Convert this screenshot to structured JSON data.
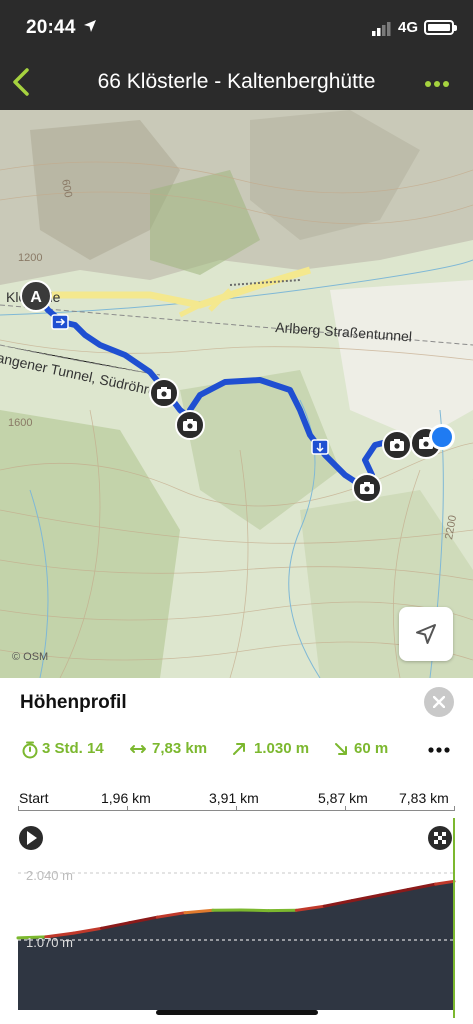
{
  "status_bar": {
    "time": "20:44",
    "network": "4G",
    "icons": [
      "location-arrow-icon",
      "signal-icon",
      "battery-icon"
    ]
  },
  "header": {
    "title": "66 Klösterle - Kaltenberghütte",
    "back_icon": "chevron-left-icon",
    "more_icon": "more-horizontal-icon"
  },
  "map": {
    "start_marker": "A",
    "labels": {
      "village": "Klösterle",
      "tunnel_1": "Arlberg Straßentunnel",
      "tunnel_2": "angener Tunnel, Südröhre",
      "contour_1200": "1200",
      "contour_1600": "1600",
      "contour_2200": "2200",
      "contour_600": "600"
    },
    "attribution": "© OSM",
    "photo_marker_icon": "camera-icon",
    "route_color": "#1f4fd1"
  },
  "elevation_panel": {
    "title": "Höhenprofil",
    "stats": {
      "duration": "3 Std. 14",
      "distance": "7,83 km",
      "ascent": "1.030 m",
      "descent": "60 m"
    },
    "distance_axis": [
      "Start",
      "1,96 km",
      "3,91 km",
      "5,87 km",
      "7,83 km"
    ],
    "elevation_labels": {
      "max": "2.040 m",
      "min": "1.070 m"
    },
    "accent_color": "#7cb82f"
  },
  "chart_data": {
    "type": "area",
    "title": "Höhenprofil",
    "xlabel": "",
    "ylabel": "",
    "x_unit": "km",
    "y_unit": "m",
    "x": [
      0,
      0.5,
      1.0,
      1.5,
      2.0,
      2.5,
      3.0,
      3.5,
      4.0,
      4.5,
      5.0,
      5.5,
      6.0,
      6.5,
      7.0,
      7.5,
      7.83
    ],
    "y": [
      1100,
      1115,
      1170,
      1240,
      1320,
      1400,
      1465,
      1500,
      1505,
      1495,
      1500,
      1560,
      1640,
      1720,
      1800,
      1880,
      1920
    ],
    "xlim": [
      0,
      7.83
    ],
    "ylim": [
      1070,
      2040
    ],
    "x_ticks": [
      "Start",
      "1,96 km",
      "3,91 km",
      "5,87 km",
      "7,83 km"
    ],
    "y_ticks": [
      "1.070 m",
      "2.040 m"
    ]
  }
}
